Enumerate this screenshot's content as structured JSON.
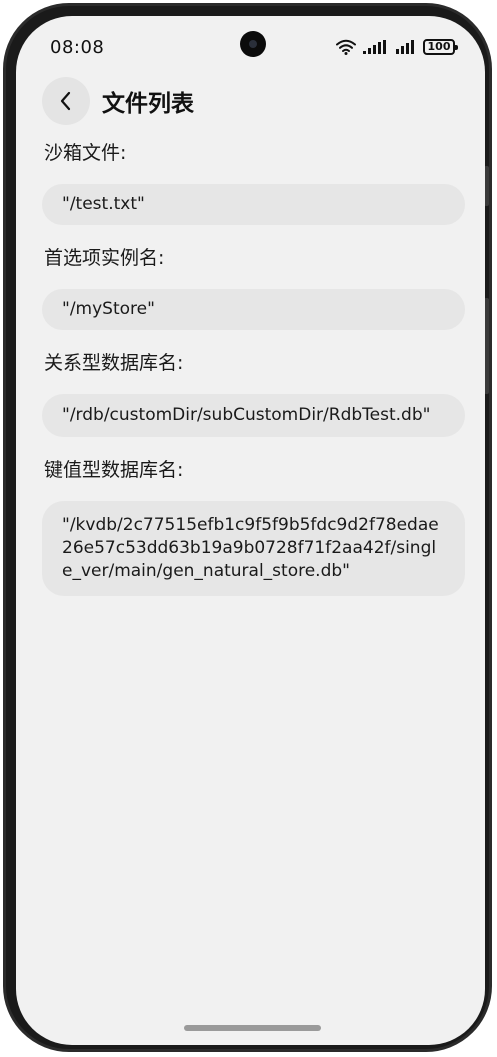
{
  "status_bar": {
    "time": "08:08",
    "battery": "100"
  },
  "header": {
    "title": "文件列表"
  },
  "sections": [
    {
      "label": "沙箱文件:",
      "value": "\"/test.txt\""
    },
    {
      "label": "首选项实例名:",
      "value": "\"/myStore\""
    },
    {
      "label": "关系型数据库名:",
      "value": "\"/rdb/customDir/subCustomDir/RdbTest.db\""
    },
    {
      "label": "键值型数据库名:",
      "value": "\"/kvdb/2c77515efb1c9f5f9b5fdc9d2f78edae26e57c53dd63b19a9b0728f71f2aa42f/single_ver/main/gen_natural_store.db\""
    }
  ],
  "icons": {
    "back": "chevron-left-icon",
    "wifi": "wifi-icon",
    "signal": "signal-icon",
    "battery": "battery-icon"
  },
  "colors": {
    "background": "#f1f1f1",
    "box": "#e6e6e6",
    "text": "#1a1a1a"
  }
}
